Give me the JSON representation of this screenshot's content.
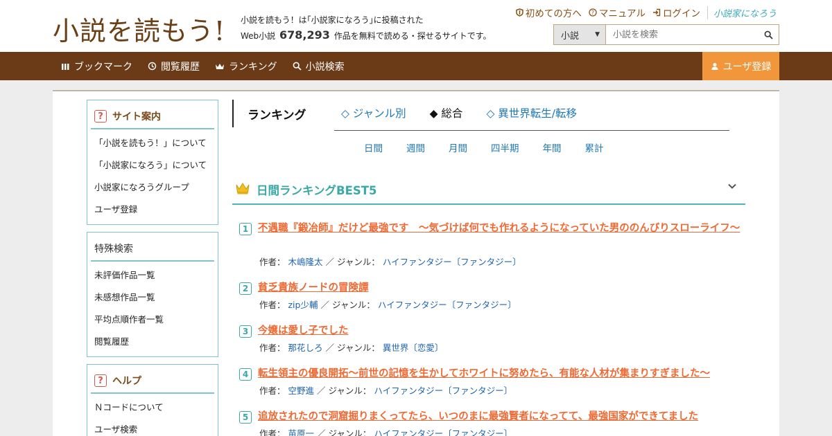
{
  "header": {
    "logo": "小説を読もう!",
    "tagline_line1": "小説を読もう！は｢小説家になろう｣に投稿された",
    "tagline_prefix": "Web小説",
    "work_count": "678,293",
    "tagline_suffix": "作品を無料で読める・探せるサイトです。",
    "links": [
      {
        "label": "初めての方へ"
      },
      {
        "label": "マニュアル"
      },
      {
        "label": "ログイン"
      }
    ],
    "brand": "小説家になろう",
    "search": {
      "category": "小説",
      "placeholder": "小説を検索"
    }
  },
  "nav": {
    "items": [
      {
        "label": "ブックマーク"
      },
      {
        "label": "閲覧履歴"
      },
      {
        "label": "ランキング"
      },
      {
        "label": "小説検索"
      }
    ],
    "register": "ユーザ登録"
  },
  "sidebar": {
    "guide": {
      "title": "サイト案内",
      "items": [
        "「小説を読もう！」について",
        "「小説家になろう」について",
        "小説家になろうグループ",
        "ユーザ登録"
      ]
    },
    "special": {
      "title": "特殊検索",
      "items": [
        "未評価作品一覧",
        "未感想作品一覧",
        "平均点順作者一覧",
        "閲覧履歴"
      ]
    },
    "help": {
      "title": "ヘルプ",
      "items": [
        "Ｎコードについて",
        "ユーザ検索"
      ]
    }
  },
  "ranking": {
    "heading": "ランキング",
    "tabs": [
      {
        "label": "◇ ジャンル別",
        "active": false
      },
      {
        "label": "◆ 総合",
        "active": true
      },
      {
        "label": "◇ 異世界転生/転移",
        "active": false
      }
    ],
    "periods": [
      "日間",
      "週間",
      "月間",
      "四半期",
      "年間",
      "累計"
    ],
    "best_title": "日間ランキングBEST5",
    "author_label": "作者：",
    "genre_label": "／ ジャンル：",
    "entries": [
      {
        "rank": "1",
        "title": "不遇職『鍛冶師』だけど最強です　～気づけば何でも作れるようになっていた男ののんびりスローライフ～",
        "author": "木嶋隆太",
        "genre": "ハイファンタジー〔ファンタジー〕"
      },
      {
        "rank": "2",
        "title": "貧乏貴族ノードの冒険譚",
        "author": "zip少輔",
        "genre": "ハイファンタジー〔ファンタジー〕"
      },
      {
        "rank": "3",
        "title": "今嬢は愛し子でした",
        "author": "那花しろ",
        "genre": "異世界〔恋愛〕"
      },
      {
        "rank": "4",
        "title": "転生領主の優良開拓〜前世の記憶を生かしてホワイトに努めたら、有能な人材が集まりすぎました〜",
        "author": "空野進",
        "genre": "ハイファンタジー〔ファンタジー〕"
      },
      {
        "rank": "5",
        "title": "追放されたので洞窟掘りまくってたら、いつのまに最強賢者になってて、最強国家ができてました",
        "author": "苗原一",
        "genre": "ハイファンタジー〔ファンタジー〕"
      }
    ]
  },
  "colors": {
    "brown": "#6b3b17",
    "orange": "#f2963c",
    "teal": "#3aa9a6",
    "title_orange": "#ee6a34",
    "link_blue": "#1e63b0"
  }
}
